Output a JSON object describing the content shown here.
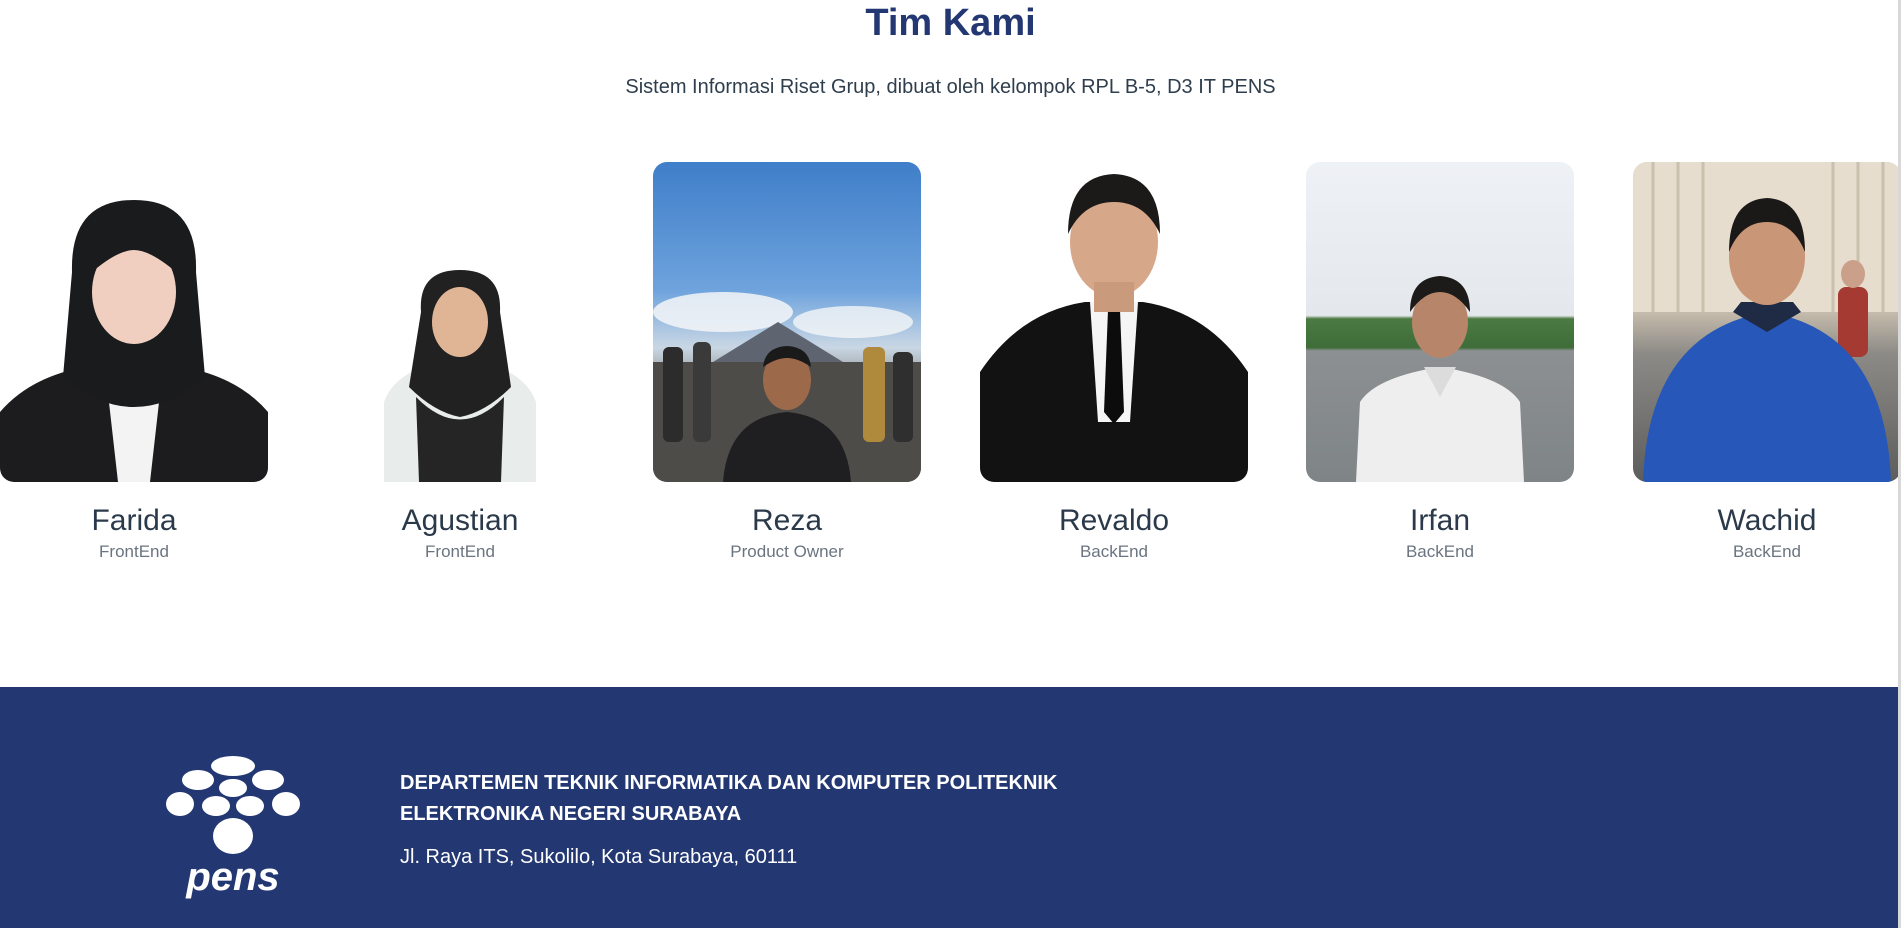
{
  "team": {
    "title": "Tim Kami",
    "subtitle": "Sistem Informasi Riset Grup, dibuat oleh kelompok RPL B-5, D3 IT PENS",
    "members": [
      {
        "name": "Farida",
        "role": "FrontEnd"
      },
      {
        "name": "Agustian",
        "role": "FrontEnd"
      },
      {
        "name": "Reza",
        "role": "Product Owner"
      },
      {
        "name": "Revaldo",
        "role": "BackEnd"
      },
      {
        "name": "Irfan",
        "role": "BackEnd"
      },
      {
        "name": "Wachid",
        "role": "BackEnd"
      }
    ]
  },
  "footer": {
    "logo_text": "pens",
    "title": "DEPARTEMEN TEKNIK INFORMATIKA DAN KOMPUTER POLITEKNIK ELEKTRONIKA NEGERI SURABAYA",
    "address": "Jl. Raya ITS, Sukolilo, Kota Surabaya, 60111"
  },
  "colors": {
    "brand_navy": "#233873",
    "text_dark": "#2b3a4a",
    "text_muted": "#6a7480"
  }
}
